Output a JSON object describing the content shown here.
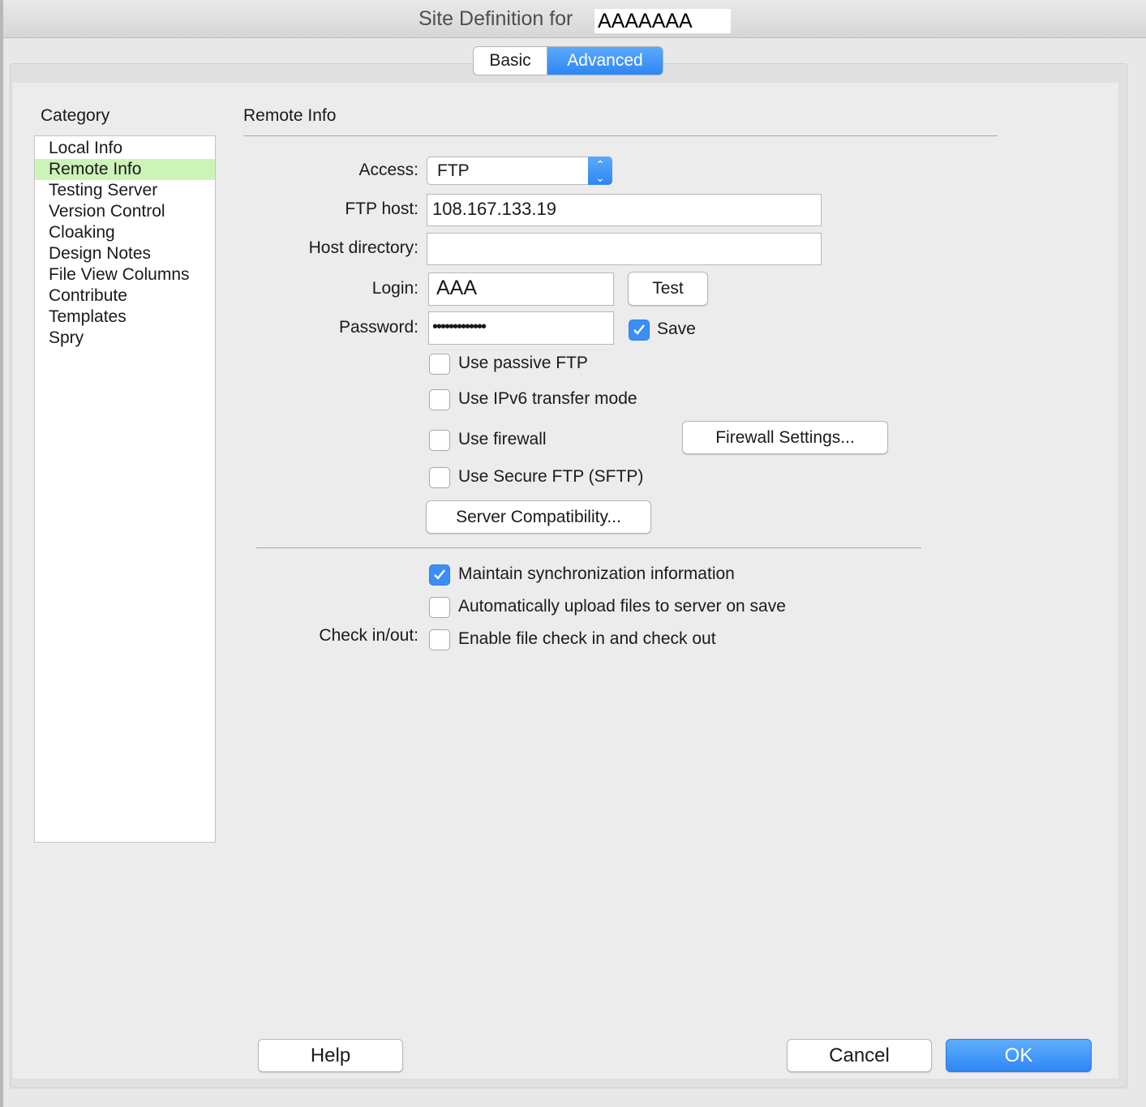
{
  "window": {
    "title_prefix": "Site Definition for",
    "site_name": "AAAAAAA"
  },
  "tabs": [
    {
      "label": "Basic",
      "active": false
    },
    {
      "label": "Advanced",
      "active": true
    }
  ],
  "category": {
    "label": "Category",
    "items": [
      "Local Info",
      "Remote Info",
      "Testing Server",
      "Version Control",
      "Cloaking",
      "Design Notes",
      "File View Columns",
      "Contribute",
      "Templates",
      "Spry"
    ],
    "selected": "Remote Info"
  },
  "remote": {
    "section_title": "Remote Info",
    "access_label": "Access:",
    "access_value": "FTP",
    "ftp_host_label": "FTP host:",
    "ftp_host_value": "108.167.133.19",
    "host_dir_label": "Host directory:",
    "host_dir_value": "",
    "login_label": "Login:",
    "login_value": "AAA",
    "test_button": "Test",
    "password_label": "Password:",
    "password_value": "•••••••••••••",
    "save_label": "Save",
    "save_checked": true,
    "passive_label": "Use passive FTP",
    "ipv6_label": "Use IPv6 transfer mode",
    "firewall_label": "Use firewall",
    "firewall_button": "Firewall Settings...",
    "sftp_label": "Use Secure FTP (SFTP)",
    "server_compat_button": "Server Compatibility...",
    "maintain_sync_label": "Maintain synchronization information",
    "maintain_sync_checked": true,
    "auto_upload_label": "Automatically upload files to server on save",
    "checkinout_label": "Check in/out:",
    "enable_checkout_label": "Enable file check in and check out"
  },
  "footer": {
    "help": "Help",
    "cancel": "Cancel",
    "ok": "OK"
  },
  "colors": {
    "accent": "#2f87f4",
    "selection": "#cdf4b8"
  }
}
